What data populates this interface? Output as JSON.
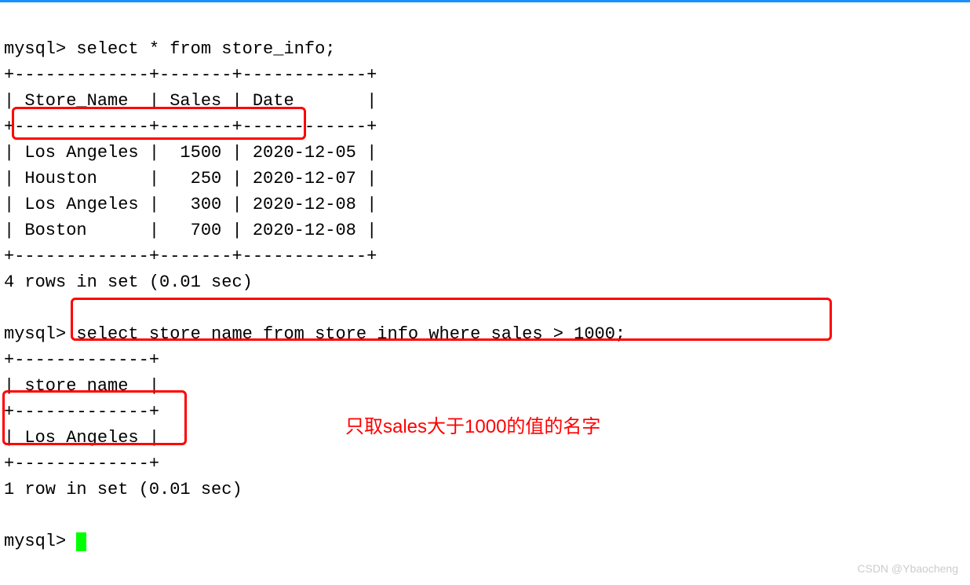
{
  "terminal": {
    "prompt": "mysql>",
    "query1": "select * from store_info;",
    "table1_border_top": "+-------------+-------+------------+",
    "table1_header": "| Store_Name  | Sales | Date       |",
    "table1_border_mid": "+-------------+-------+------------+",
    "table1_rows": [
      "| Los Angeles |  1500 | 2020-12-05 |",
      "| Houston     |   250 | 2020-12-07 |",
      "| Los Angeles |   300 | 2020-12-08 |",
      "| Boston      |   700 | 2020-12-08 |"
    ],
    "table1_border_bot": "+-------------+-------+------------+",
    "result1": "4 rows in set (0.01 sec)",
    "query2": "select store_name from store_info where sales > 1000;",
    "table2_border_top": "+-------------+",
    "table2_header": "| store_name  |",
    "table2_border_mid": "+-------------+",
    "table2_row": "| Los Angeles |",
    "table2_border_bot": "+-------------+",
    "result2": "1 row in set (0.01 sec)"
  },
  "annotation": {
    "text": "只取sales大于1000的值的名字"
  },
  "watermark": "CSDN @Ybaocheng",
  "chart_data": {
    "type": "table",
    "tables": [
      {
        "title": "store_info",
        "columns": [
          "Store_Name",
          "Sales",
          "Date"
        ],
        "rows": [
          [
            "Los Angeles",
            1500,
            "2020-12-05"
          ],
          [
            "Houston",
            250,
            "2020-12-07"
          ],
          [
            "Los Angeles",
            300,
            "2020-12-08"
          ],
          [
            "Boston",
            700,
            "2020-12-08"
          ]
        ]
      },
      {
        "title": "query result where sales > 1000",
        "columns": [
          "store_name"
        ],
        "rows": [
          [
            "Los Angeles"
          ]
        ]
      }
    ]
  }
}
